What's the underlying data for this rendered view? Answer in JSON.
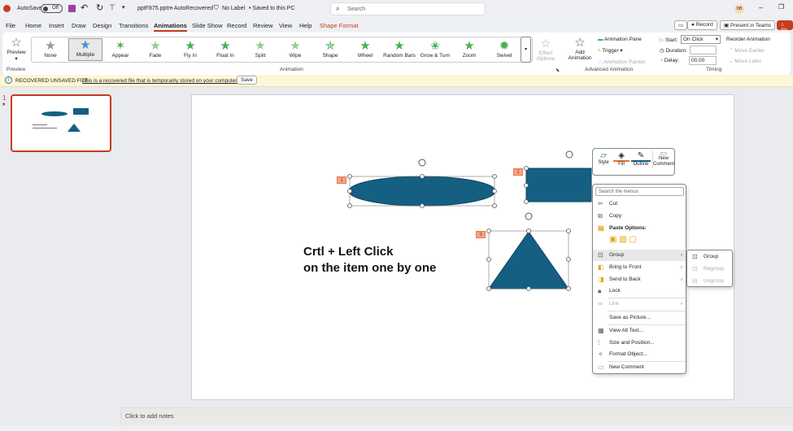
{
  "titlebar": {
    "autosave": "AutoSave",
    "toggle": "Off",
    "filename": "pptF875.pptm",
    "autorecovered": "- AutoRecovered",
    "label": "No Label",
    "saved": "• Saved to this PC",
    "search_placeholder": "Search",
    "user_initials": "DB"
  },
  "tabs": [
    "File",
    "Home",
    "Insert",
    "Draw",
    "Design",
    "Transitions",
    "Animations",
    "Slide Show",
    "Record",
    "Review",
    "View",
    "Help",
    "Shape Format"
  ],
  "topright": {
    "record": "Record",
    "present": "Present in Teams",
    "share": "Sh"
  },
  "ribbon": {
    "preview": "Preview",
    "preview_group": "Preview",
    "effects": [
      "None",
      "Multiple",
      "Appear",
      "Fade",
      "Fly In",
      "Float In",
      "Split",
      "Wipe",
      "Shape",
      "Wheel",
      "Random Bars",
      "Grow & Turn",
      "Zoom",
      "Swivel"
    ],
    "effect_options": "Effect Options",
    "animation_group": "Animation",
    "add_animation": "Add Animation",
    "animation_pane": "Animation Pane",
    "trigger": "Trigger",
    "animation_painter": "Animation Painter",
    "advanced_group": "Advanced Animation",
    "start_label": "Start:",
    "start_value": "On Click",
    "duration_label": "Duration:",
    "duration_value": "",
    "delay_label": "Delay:",
    "delay_value": "00.00",
    "reorder": "Reorder Animation",
    "move_earlier": "Move Earlier",
    "move_later": "Move Later",
    "timing_group": "Timing"
  },
  "infobar": {
    "title": "RECOVERED UNSAVED FILE",
    "message": "This is a recovered file that is temporarily stored on your computer.",
    "save": "Save"
  },
  "thumbnail": {
    "number": "1"
  },
  "slide": {
    "line1": "Crtl + Left Click",
    "line2": "on the item one by one",
    "tags": [
      "1",
      "2",
      "3"
    ],
    "shape_color": "#155f82"
  },
  "minitoolbar": {
    "style": "Style",
    "fill": "Fill",
    "outline": "Outline",
    "new_comment": "New Comment"
  },
  "menu": {
    "search_placeholder": "Search the menus",
    "cut": "Cut",
    "copy": "Copy",
    "paste_options": "Paste Options:",
    "group": "Group",
    "bring_front": "Bring to Front",
    "send_back": "Send to Back",
    "lock": "Lock",
    "link": "Link",
    "save_picture": "Save as Picture...",
    "alt_text": "View Alt Text...",
    "size_position": "Size and Position...",
    "format_object": "Format Object...",
    "new_comment": "New Comment"
  },
  "submenu": {
    "group": "Group",
    "regroup": "Regroup",
    "ungroup": "Ungroup"
  },
  "notes": {
    "placeholder": "Click to add notes"
  }
}
